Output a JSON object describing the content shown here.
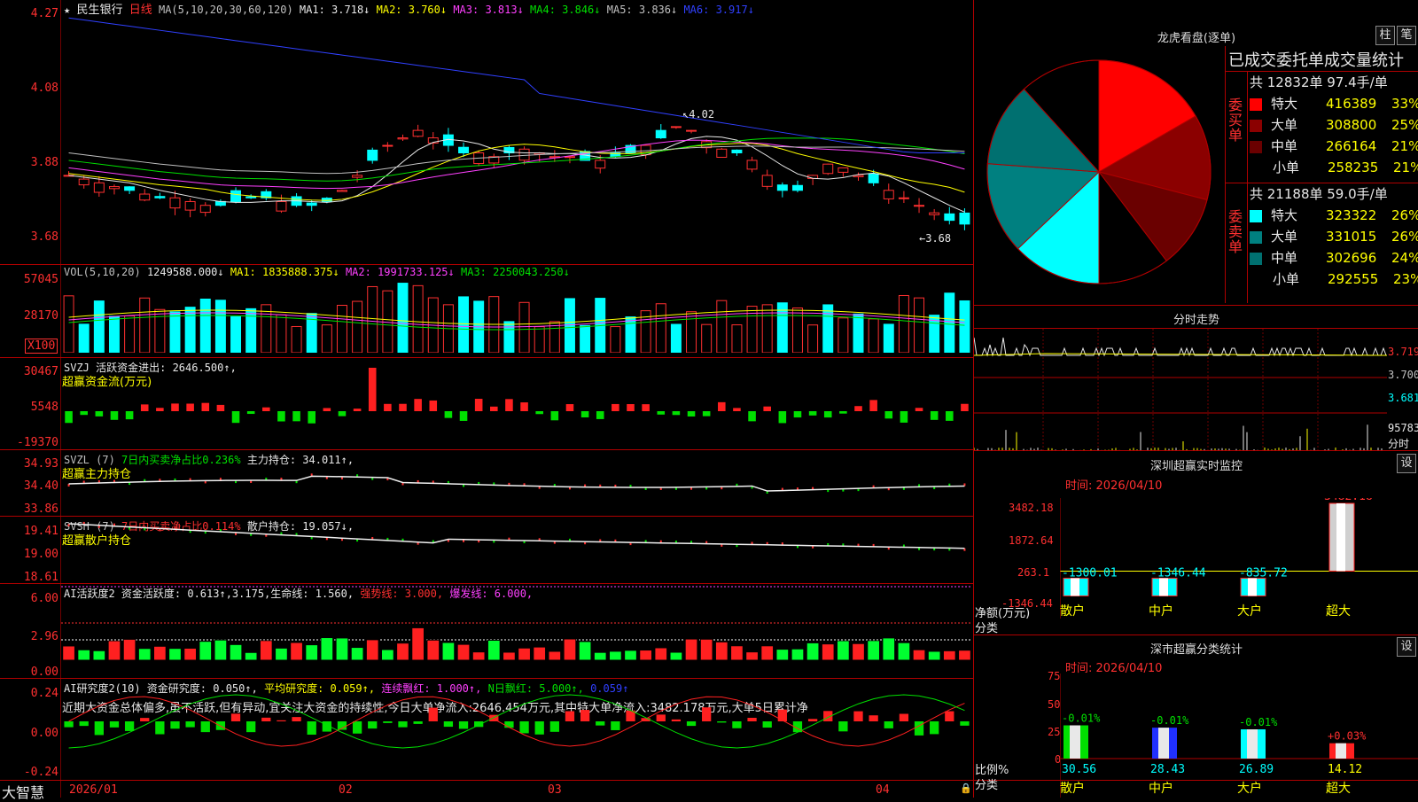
{
  "header": {
    "star": "★",
    "stock": "民生银行",
    "period": "日线",
    "ma_label": "MA(5,10,20,30,60,120)",
    "ma": [
      {
        "name": "MA1:",
        "value": "3.718↓",
        "color": "#e8e8e8"
      },
      {
        "name": "MA2:",
        "value": "3.760↓",
        "color": "#ffff00"
      },
      {
        "name": "MA3:",
        "value": "3.813↓",
        "color": "#ff40ff"
      },
      {
        "name": "MA4:",
        "value": "3.846↓",
        "color": "#00e000"
      },
      {
        "name": "MA5:",
        "value": "3.836↓",
        "color": "#c0c0c0"
      },
      {
        "name": "MA6:",
        "value": "3.917↓",
        "color": "#3040ff"
      }
    ]
  },
  "price_axis": [
    "4.27",
    "4.08",
    "3.88",
    "3.68"
  ],
  "price_hi": "4.02",
  "price_lo": "3.68",
  "vol": {
    "axis": [
      "57045",
      "28170",
      "X100"
    ],
    "title": "VOL(5,10,20)",
    "value": "1249588.000↓",
    "ma1": "MA1: 1835888.375↓",
    "ma2": "MA2: 1991733.125↓",
    "ma3": "MA3: 2250043.250↓"
  },
  "svzj": {
    "axis": [
      "30467",
      "5548",
      "-19370"
    ],
    "title": "SVZJ  活跃资金进出: 2646.500↑,",
    "subtitle": "超赢资金流(万元)"
  },
  "svzl": {
    "axis": [
      "34.93",
      "34.40",
      "33.86"
    ],
    "title": "SVZL (7)",
    "t2": "7日内买卖净占比0.236%",
    "t3": "主力持仓: 34.011↑,",
    "subtitle": "超赢主力持仓"
  },
  "svsh": {
    "axis": [
      "19.41",
      "19.00",
      "18.61"
    ],
    "title": "SVSH (7)",
    "t2": "7日内买卖净占比0.114%",
    "t3": "散户持仓: 19.057↓,",
    "subtitle": "超赢散户持仓"
  },
  "ai1": {
    "axis": [
      "6.00",
      "2.96",
      "0.00"
    ],
    "t1": "AI活跃度2 资金活跃度: 0.613↑,3.175,生命线: 1.560,",
    "t2": "强势线: 3.000,",
    "t3": "爆发线: 6.000,"
  },
  "ai2": {
    "axis": [
      "0.24",
      "0.00",
      "-0.24"
    ],
    "t1": "AI研究度2(10) 资金研究度: 0.050↑,",
    "t2": "平均研究度: 0.059↑,",
    "t3": "连续飘红: 1.000↑,",
    "t4": "N日飘红: 5.000↑,",
    "t5": "0.059↑",
    "comment": "近期大资金总体偏多,虽不活跃,但有异动,宜关注大资金的持续性,今日大单净流入:2646.454万元,其中特大单净流入:3482.178万元,大单5日累计净"
  },
  "xaxis": {
    "brand": "大智慧",
    "labels": [
      "2026/01",
      "02",
      "03",
      "04"
    ]
  },
  "right": {
    "dragon_title": "龙虎看盘(逐单)",
    "btn1": "柱",
    "btn2": "笔",
    "stat_title": "已成交委托单成交量统计",
    "buy": {
      "label": "委买单",
      "summary": "共 12832单 97.4手/单",
      "rows": [
        {
          "name": "特大",
          "vol": "416389",
          "pct": "33%",
          "color": "#ff0000"
        },
        {
          "name": "大单",
          "vol": "308800",
          "pct": "25%",
          "color": "#8b0000"
        },
        {
          "name": "中单",
          "vol": "266164",
          "pct": "21%",
          "color": "#6a0000"
        },
        {
          "name": "小单",
          "vol": "258235",
          "pct": "21%",
          "color": "#000000"
        }
      ]
    },
    "sell": {
      "label": "委卖单",
      "summary": "共 21188单 59.0手/单",
      "rows": [
        {
          "name": "特大",
          "vol": "323322",
          "pct": "26%",
          "color": "#00ffff"
        },
        {
          "name": "大单",
          "vol": "331015",
          "pct": "26%",
          "color": "#008080"
        },
        {
          "name": "中单",
          "vol": "302696",
          "pct": "24%",
          "color": "#007070"
        },
        {
          "name": "小单",
          "vol": "292555",
          "pct": "23%",
          "color": "#000000"
        }
      ]
    },
    "intraday": {
      "title": "分时走势",
      "axis": [
        "3.719",
        "3.700",
        "3.681"
      ],
      "vol_top": "95783",
      "vol_label": "分时"
    },
    "sz_monitor": {
      "title": "深圳超赢实时监控",
      "btn": "设",
      "time": "时间: 2026/04/10",
      "axis": [
        "3482.18",
        "1872.64",
        "263.1",
        "-1346.44"
      ],
      "ylabel": "净额(万元)",
      "xlabel": "分类",
      "cats": [
        "散户",
        "中户",
        "大户",
        "超大"
      ],
      "values": [
        "-1300.01",
        "-1346.44",
        "-835.72",
        "3482.18"
      ]
    },
    "sz_class": {
      "title": "深市超赢分类统计",
      "btn": "设",
      "time": "时间: 2026/04/10",
      "axis": [
        "75",
        "50",
        "25",
        "0"
      ],
      "ylabel": "比例%",
      "xlabel": "分类",
      "cats": [
        "散户",
        "中户",
        "大户",
        "超大"
      ],
      "changes": [
        "-0.01%",
        "-0.01%",
        "-0.01%",
        "+0.03%"
      ],
      "values": [
        "30.56",
        "28.43",
        "26.89",
        "14.12"
      ]
    }
  },
  "chart_data": [
    {
      "type": "pie",
      "title": "龙虎看盘(逐单)",
      "categories": [
        "买特大",
        "买大单",
        "买中单",
        "买小单",
        "卖特大",
        "卖大单",
        "卖中单",
        "卖小单"
      ],
      "values": [
        416389,
        308800,
        266164,
        258235,
        323322,
        331015,
        302696,
        292555
      ]
    },
    {
      "type": "bar",
      "title": "深圳超赢实时监控",
      "categories": [
        "散户",
        "中户",
        "大户",
        "超大"
      ],
      "values": [
        -1300.01,
        -1346.44,
        -835.72,
        3482.18
      ],
      "ylim": [
        -1346.44,
        3482.18
      ]
    },
    {
      "type": "bar",
      "title": "深市超赢分类统计",
      "categories": [
        "散户",
        "中户",
        "大户",
        "超大"
      ],
      "values": [
        30.56,
        28.43,
        26.89,
        14.12
      ],
      "ylim": [
        0,
        75
      ]
    }
  ]
}
